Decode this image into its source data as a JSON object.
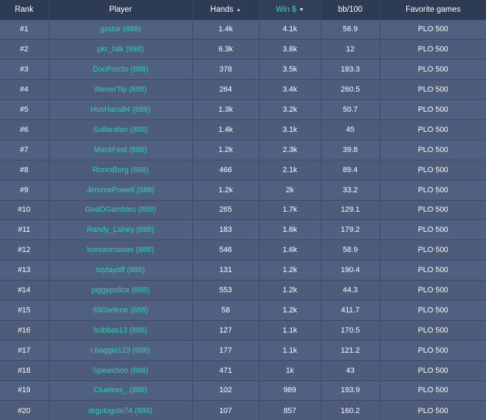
{
  "columns": {
    "rank": "Rank",
    "player": "Player",
    "hands": "Hands",
    "win": "Win $",
    "bb100": "bb/100",
    "favorite": "Favorite games"
  },
  "icons": {
    "hands_sort": "caret-up-icon",
    "win_sort": "caret-down-icon"
  },
  "colors": {
    "header_bg": "#2e3b55",
    "row_bg": "#4e5c7c",
    "accent": "#2fd8b5",
    "link": "#2fd0b0"
  },
  "rows": [
    {
      "rank": "#1",
      "player": "gzstar (888)",
      "hands": "1.4k",
      "win": "4.1k",
      "bb100": "56.9",
      "favorite": "PLO 500"
    },
    {
      "rank": "#2",
      "player": "pkr_falk (888)",
      "hands": "6.3k",
      "win": "3.8k",
      "bb100": "12",
      "favorite": "PLO 500"
    },
    {
      "rank": "#3",
      "player": "DocProcto (888)",
      "hands": "378",
      "win": "3.5k",
      "bb100": "183.3",
      "favorite": "PLO 500"
    },
    {
      "rank": "#4",
      "player": "iNeverTip (888)",
      "hands": "264",
      "win": "3.4k",
      "bb100": "260.5",
      "favorite": "PLO 500"
    },
    {
      "rank": "#5",
      "player": "HusHans84 (888)",
      "hands": "1.3k",
      "win": "3.2k",
      "bb100": "50.7",
      "favorite": "PLO 500"
    },
    {
      "rank": "#6",
      "player": "Sulfarafan (888)",
      "hands": "1.4k",
      "win": "3.1k",
      "bb100": "45",
      "favorite": "PLO 500"
    },
    {
      "rank": "#7",
      "player": "MuckFest (888)",
      "hands": "1.2k",
      "win": "2.3k",
      "bb100": "39.8",
      "favorite": "PLO 500"
    },
    {
      "rank": "#8",
      "player": "RonniBorg (888)",
      "hands": "466",
      "win": "2.1k",
      "bb100": "89.4",
      "favorite": "PLO 500"
    },
    {
      "rank": "#9",
      "player": "JeromePowell (888)",
      "hands": "1.2k",
      "win": "2k",
      "bb100": "33.2",
      "favorite": "PLO 500"
    },
    {
      "rank": "#10",
      "player": "GodOGambles (888)",
      "hands": "265",
      "win": "1.7k",
      "bb100": "129.1",
      "favorite": "PLO 500"
    },
    {
      "rank": "#11",
      "player": "Randy_Lahey (888)",
      "hands": "183",
      "win": "1.6k",
      "bb100": "179.2",
      "favorite": "PLO 500"
    },
    {
      "rank": "#12",
      "player": "koreanmaster (888)",
      "hands": "546",
      "win": "1.6k",
      "bb100": "58.9",
      "favorite": "PLO 500"
    },
    {
      "rank": "#13",
      "player": "taytayoff (888)",
      "hands": "131",
      "win": "1.2k",
      "bb100": "190.4",
      "favorite": "PLO 500"
    },
    {
      "rank": "#14",
      "player": "piggypolice (888)",
      "hands": "553",
      "win": "1.2k",
      "bb100": "44.3",
      "favorite": "PLO 500"
    },
    {
      "rank": "#15",
      "player": "69Darlene (888)",
      "hands": "58",
      "win": "1.2k",
      "bb100": "411.7",
      "favorite": "PLO 500"
    },
    {
      "rank": "#16",
      "player": "bubbas13 (888)",
      "hands": "127",
      "win": "1.1k",
      "bb100": "170.5",
      "favorite": "PLO 500"
    },
    {
      "rank": "#17",
      "player": "r.baggio123 (888)",
      "hands": "177",
      "win": "1.1k",
      "bb100": "121.2",
      "favorite": "PLO 500"
    },
    {
      "rank": "#18",
      "player": "Spewchoo (888)",
      "hands": "471",
      "win": "1k",
      "bb100": "43",
      "favorite": "PLO 500"
    },
    {
      "rank": "#19",
      "player": "Clueless_ (888)",
      "hands": "102",
      "win": "989",
      "bb100": "193.9",
      "favorite": "PLO 500"
    },
    {
      "rank": "#20",
      "player": "drgulogulo74 (888)",
      "hands": "107",
      "win": "857",
      "bb100": "160.2",
      "favorite": "PLO 500"
    }
  ]
}
